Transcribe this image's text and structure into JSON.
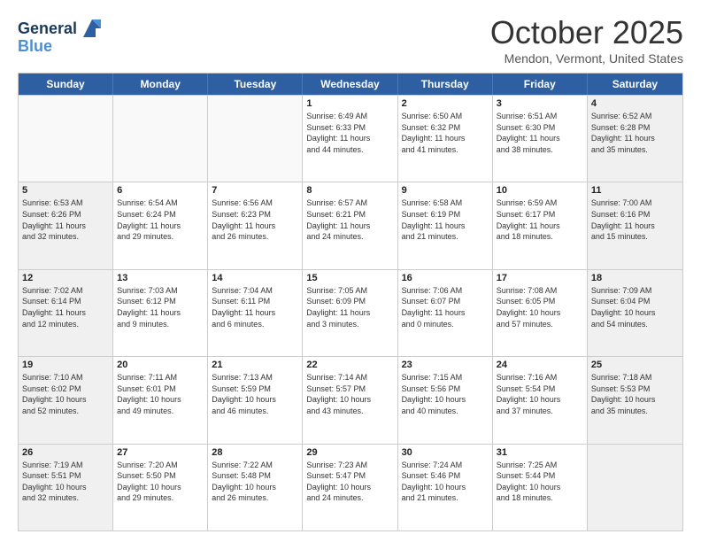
{
  "header": {
    "logo_line1": "General",
    "logo_line2": "Blue",
    "month_title": "October 2025",
    "location": "Mendon, Vermont, United States"
  },
  "weekdays": [
    "Sunday",
    "Monday",
    "Tuesday",
    "Wednesday",
    "Thursday",
    "Friday",
    "Saturday"
  ],
  "rows": [
    [
      {
        "day": "",
        "info": "",
        "empty": true
      },
      {
        "day": "",
        "info": "",
        "empty": true
      },
      {
        "day": "",
        "info": "",
        "empty": true
      },
      {
        "day": "1",
        "info": "Sunrise: 6:49 AM\nSunset: 6:33 PM\nDaylight: 11 hours\nand 44 minutes.",
        "empty": false
      },
      {
        "day": "2",
        "info": "Sunrise: 6:50 AM\nSunset: 6:32 PM\nDaylight: 11 hours\nand 41 minutes.",
        "empty": false
      },
      {
        "day": "3",
        "info": "Sunrise: 6:51 AM\nSunset: 6:30 PM\nDaylight: 11 hours\nand 38 minutes.",
        "empty": false
      },
      {
        "day": "4",
        "info": "Sunrise: 6:52 AM\nSunset: 6:28 PM\nDaylight: 11 hours\nand 35 minutes.",
        "empty": false,
        "shaded": true
      }
    ],
    [
      {
        "day": "5",
        "info": "Sunrise: 6:53 AM\nSunset: 6:26 PM\nDaylight: 11 hours\nand 32 minutes.",
        "empty": false,
        "shaded": true
      },
      {
        "day": "6",
        "info": "Sunrise: 6:54 AM\nSunset: 6:24 PM\nDaylight: 11 hours\nand 29 minutes.",
        "empty": false
      },
      {
        "day": "7",
        "info": "Sunrise: 6:56 AM\nSunset: 6:23 PM\nDaylight: 11 hours\nand 26 minutes.",
        "empty": false
      },
      {
        "day": "8",
        "info": "Sunrise: 6:57 AM\nSunset: 6:21 PM\nDaylight: 11 hours\nand 24 minutes.",
        "empty": false
      },
      {
        "day": "9",
        "info": "Sunrise: 6:58 AM\nSunset: 6:19 PM\nDaylight: 11 hours\nand 21 minutes.",
        "empty": false
      },
      {
        "day": "10",
        "info": "Sunrise: 6:59 AM\nSunset: 6:17 PM\nDaylight: 11 hours\nand 18 minutes.",
        "empty": false
      },
      {
        "day": "11",
        "info": "Sunrise: 7:00 AM\nSunset: 6:16 PM\nDaylight: 11 hours\nand 15 minutes.",
        "empty": false,
        "shaded": true
      }
    ],
    [
      {
        "day": "12",
        "info": "Sunrise: 7:02 AM\nSunset: 6:14 PM\nDaylight: 11 hours\nand 12 minutes.",
        "empty": false,
        "shaded": true
      },
      {
        "day": "13",
        "info": "Sunrise: 7:03 AM\nSunset: 6:12 PM\nDaylight: 11 hours\nand 9 minutes.",
        "empty": false
      },
      {
        "day": "14",
        "info": "Sunrise: 7:04 AM\nSunset: 6:11 PM\nDaylight: 11 hours\nand 6 minutes.",
        "empty": false
      },
      {
        "day": "15",
        "info": "Sunrise: 7:05 AM\nSunset: 6:09 PM\nDaylight: 11 hours\nand 3 minutes.",
        "empty": false
      },
      {
        "day": "16",
        "info": "Sunrise: 7:06 AM\nSunset: 6:07 PM\nDaylight: 11 hours\nand 0 minutes.",
        "empty": false
      },
      {
        "day": "17",
        "info": "Sunrise: 7:08 AM\nSunset: 6:05 PM\nDaylight: 10 hours\nand 57 minutes.",
        "empty": false
      },
      {
        "day": "18",
        "info": "Sunrise: 7:09 AM\nSunset: 6:04 PM\nDaylight: 10 hours\nand 54 minutes.",
        "empty": false,
        "shaded": true
      }
    ],
    [
      {
        "day": "19",
        "info": "Sunrise: 7:10 AM\nSunset: 6:02 PM\nDaylight: 10 hours\nand 52 minutes.",
        "empty": false,
        "shaded": true
      },
      {
        "day": "20",
        "info": "Sunrise: 7:11 AM\nSunset: 6:01 PM\nDaylight: 10 hours\nand 49 minutes.",
        "empty": false
      },
      {
        "day": "21",
        "info": "Sunrise: 7:13 AM\nSunset: 5:59 PM\nDaylight: 10 hours\nand 46 minutes.",
        "empty": false
      },
      {
        "day": "22",
        "info": "Sunrise: 7:14 AM\nSunset: 5:57 PM\nDaylight: 10 hours\nand 43 minutes.",
        "empty": false
      },
      {
        "day": "23",
        "info": "Sunrise: 7:15 AM\nSunset: 5:56 PM\nDaylight: 10 hours\nand 40 minutes.",
        "empty": false
      },
      {
        "day": "24",
        "info": "Sunrise: 7:16 AM\nSunset: 5:54 PM\nDaylight: 10 hours\nand 37 minutes.",
        "empty": false
      },
      {
        "day": "25",
        "info": "Sunrise: 7:18 AM\nSunset: 5:53 PM\nDaylight: 10 hours\nand 35 minutes.",
        "empty": false,
        "shaded": true
      }
    ],
    [
      {
        "day": "26",
        "info": "Sunrise: 7:19 AM\nSunset: 5:51 PM\nDaylight: 10 hours\nand 32 minutes.",
        "empty": false,
        "shaded": true
      },
      {
        "day": "27",
        "info": "Sunrise: 7:20 AM\nSunset: 5:50 PM\nDaylight: 10 hours\nand 29 minutes.",
        "empty": false
      },
      {
        "day": "28",
        "info": "Sunrise: 7:22 AM\nSunset: 5:48 PM\nDaylight: 10 hours\nand 26 minutes.",
        "empty": false
      },
      {
        "day": "29",
        "info": "Sunrise: 7:23 AM\nSunset: 5:47 PM\nDaylight: 10 hours\nand 24 minutes.",
        "empty": false
      },
      {
        "day": "30",
        "info": "Sunrise: 7:24 AM\nSunset: 5:46 PM\nDaylight: 10 hours\nand 21 minutes.",
        "empty": false
      },
      {
        "day": "31",
        "info": "Sunrise: 7:25 AM\nSunset: 5:44 PM\nDaylight: 10 hours\nand 18 minutes.",
        "empty": false
      },
      {
        "day": "",
        "info": "",
        "empty": true,
        "shaded": true
      }
    ]
  ]
}
